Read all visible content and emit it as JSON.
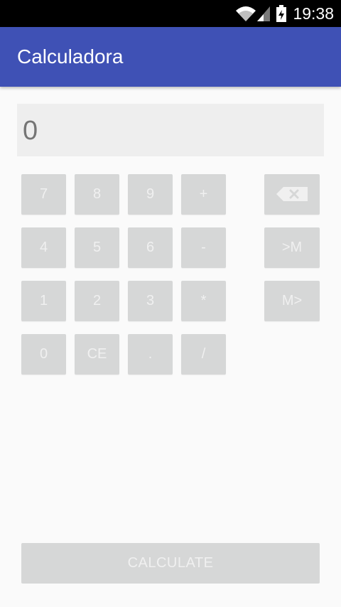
{
  "status_bar": {
    "time": "19:38",
    "icons": [
      "wifi-icon",
      "signal-icon",
      "battery-icon"
    ]
  },
  "app_bar": {
    "title": "Calculadora",
    "color": "#3f51b5"
  },
  "display": {
    "value": "0"
  },
  "keypad": {
    "row1": [
      "7",
      "8",
      "9",
      "+"
    ],
    "row2": [
      "4",
      "5",
      "6",
      "-"
    ],
    "row3": [
      "1",
      "2",
      "3",
      "*"
    ],
    "row4": [
      "0",
      "CE",
      ".",
      "/"
    ],
    "side": {
      "backspace_icon": "backspace-icon",
      "memory_store": ">M",
      "memory_recall": "M>"
    }
  },
  "calculate_button": {
    "label": "CALCULATE"
  },
  "colors": {
    "key_background": "#d6d7d7",
    "key_text": "#f0f0f0",
    "display_background": "#eeeeee",
    "display_text": "#757575",
    "page_background": "#fafafa"
  }
}
